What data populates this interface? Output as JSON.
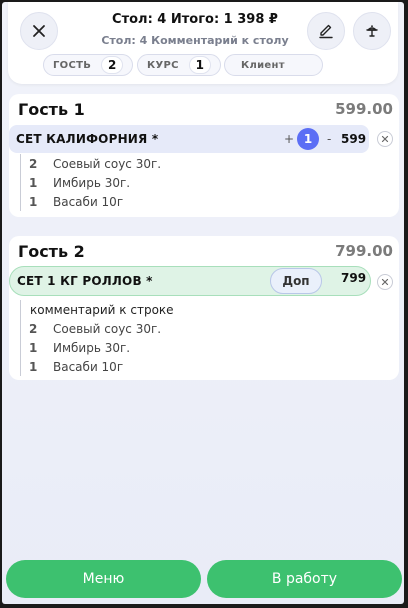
{
  "header": {
    "title": "Стол: 4 Итого: 1 398 ₽",
    "subtitle": "Стол: 4 Комментарий к столу",
    "guest_chip": {
      "label": "ГОСТЬ",
      "value": "2"
    },
    "course_chip": {
      "label": "КУРС",
      "value": "1"
    },
    "client_chip": {
      "label": "Клиент"
    }
  },
  "guests": [
    {
      "name": "Гость 1",
      "total": "599.00",
      "item": {
        "name": "СЕТ КАЛИФОРНИЯ *",
        "plus": "+",
        "count": "1",
        "minus": "-",
        "price": "599",
        "modifiers": [
          {
            "qty": "2",
            "name": "Соевый соус 30г."
          },
          {
            "qty": "1",
            "name": "Имбирь 30г."
          },
          {
            "qty": "1",
            "name": "Васаби 10г"
          }
        ]
      }
    },
    {
      "name": "Гость 2",
      "total": "799.00",
      "item": {
        "name": "СЕТ 1 КГ РОЛЛОВ *",
        "extra_label": "Доп",
        "price": "799",
        "comment": "комментарий к строке",
        "modifiers": [
          {
            "qty": "2",
            "name": "Соевый соус 30г."
          },
          {
            "qty": "1",
            "name": "Имбирь 30г."
          },
          {
            "qty": "1",
            "name": "Васаби 10г"
          }
        ]
      }
    }
  ],
  "footer": {
    "menu_label": "Меню",
    "work_label": "В работу"
  },
  "colors": {
    "accent_green": "#3dc16f",
    "counter_blue": "#5b6ef5",
    "row_selected": "#e6eaf9",
    "row_green": "#dff3e6"
  }
}
